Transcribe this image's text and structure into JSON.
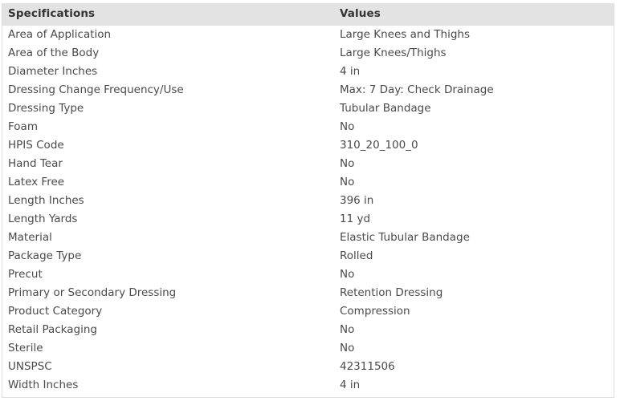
{
  "table": {
    "columns": [
      "Specifications",
      "Values"
    ],
    "rows": [
      {
        "spec": "Area of Application",
        "value": "Large Knees and Thighs"
      },
      {
        "spec": "Area of the Body",
        "value": "Large Knees/Thighs"
      },
      {
        "spec": "Diameter Inches",
        "value": "4 in"
      },
      {
        "spec": "Dressing Change Frequency/Use",
        "value": "Max: 7 Day: Check Drainage"
      },
      {
        "spec": "Dressing Type",
        "value": "Tubular Bandage"
      },
      {
        "spec": "Foam",
        "value": "No"
      },
      {
        "spec": "HPIS Code",
        "value": "310_20_100_0"
      },
      {
        "spec": "Hand Tear",
        "value": "No"
      },
      {
        "spec": "Latex Free",
        "value": "No"
      },
      {
        "spec": "Length Inches",
        "value": "396 in"
      },
      {
        "spec": "Length Yards",
        "value": "11 yd"
      },
      {
        "spec": "Material",
        "value": "Elastic Tubular Bandage"
      },
      {
        "spec": "Package Type",
        "value": "Rolled"
      },
      {
        "spec": "Precut",
        "value": "No"
      },
      {
        "spec": "Primary or Secondary Dressing",
        "value": "Retention Dressing"
      },
      {
        "spec": "Product Category",
        "value": "Compression"
      },
      {
        "spec": "Retail Packaging",
        "value": "No"
      },
      {
        "spec": "Sterile",
        "value": "No"
      },
      {
        "spec": "UNSPSC",
        "value": "42311506"
      },
      {
        "spec": "Width Inches",
        "value": "4 in"
      }
    ]
  },
  "colors": {
    "header_background": "#e3e3e3",
    "header_text": "#333333",
    "body_text": "#4a4a4a",
    "border": "#dcdcdc",
    "page_background": "#ffffff"
  }
}
